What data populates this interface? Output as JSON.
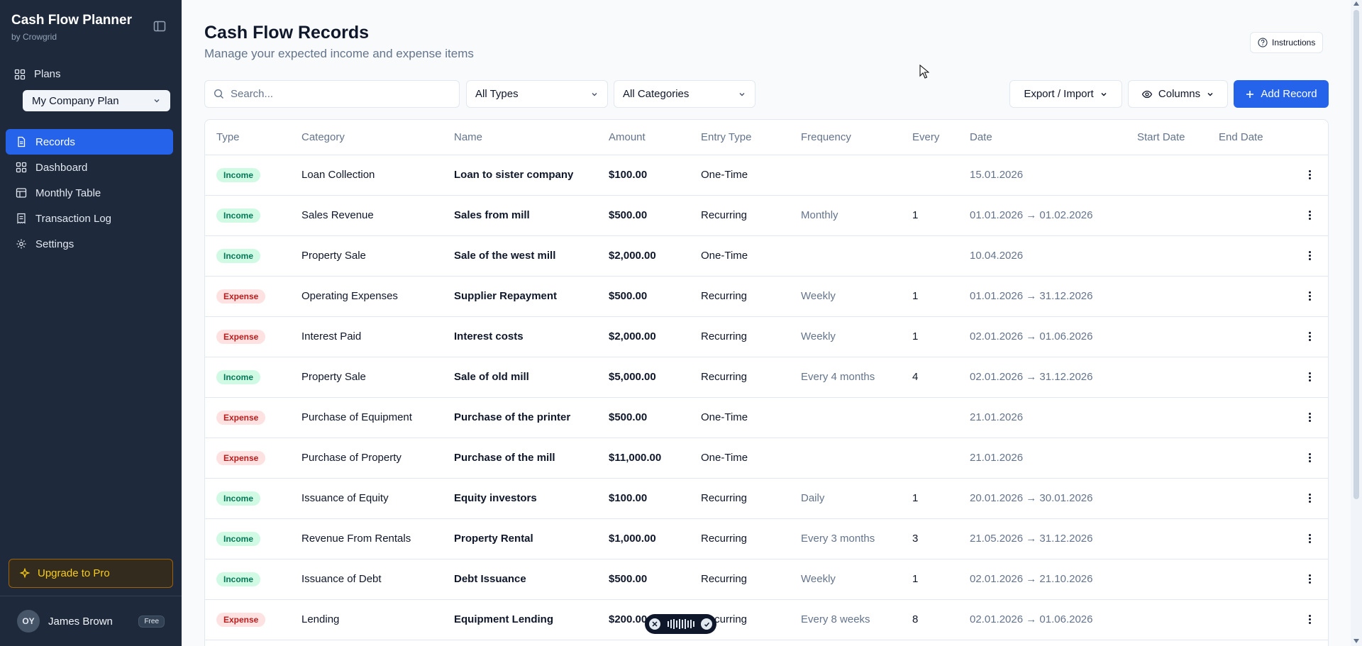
{
  "sidebar": {
    "app_title": "Cash Flow Planner",
    "app_subtitle": "by Crowgrid",
    "plans_label": "Plans",
    "plan_selected": "My Company Plan",
    "nav": [
      {
        "label": "Records",
        "icon": "file-text-icon",
        "active": true
      },
      {
        "label": "Dashboard",
        "icon": "grid-icon",
        "active": false
      },
      {
        "label": "Monthly Table",
        "icon": "table-icon",
        "active": false
      },
      {
        "label": "Transaction Log",
        "icon": "receipt-icon",
        "active": false
      },
      {
        "label": "Settings",
        "icon": "gear-icon",
        "active": false
      }
    ],
    "upgrade_label": "Upgrade to Pro",
    "user": {
      "initials": "OY",
      "name": "James Brown",
      "plan": "Free"
    }
  },
  "header": {
    "title": "Cash Flow Records",
    "subtitle": "Manage your expected income and expense items",
    "instructions_label": "Instructions"
  },
  "toolbar": {
    "search_placeholder": "Search...",
    "type_filter": "All Types",
    "category_filter": "All Categories",
    "export_import_label": "Export / Import",
    "columns_label": "Columns",
    "add_record_label": "Add Record"
  },
  "table": {
    "columns": [
      "Type",
      "Category",
      "Name",
      "Amount",
      "Entry Type",
      "Frequency",
      "Every",
      "Date",
      "Start Date",
      "End Date"
    ],
    "rows": [
      {
        "type": "Income",
        "category": "Loan Collection",
        "name": "Loan to sister company",
        "amount": "$100.00",
        "entry_type": "One-Time",
        "frequency": "",
        "every": "",
        "date": "15.01.2026"
      },
      {
        "type": "Income",
        "category": "Sales Revenue",
        "name": "Sales from mill",
        "amount": "$500.00",
        "entry_type": "Recurring",
        "frequency": "Monthly",
        "every": "1",
        "date": "01.01.2026 → 01.02.2026"
      },
      {
        "type": "Income",
        "category": "Property Sale",
        "name": "Sale of the west mill",
        "amount": "$2,000.00",
        "entry_type": "One-Time",
        "frequency": "",
        "every": "",
        "date": "10.04.2026"
      },
      {
        "type": "Expense",
        "category": "Operating Expenses",
        "name": "Supplier Repayment",
        "amount": "$500.00",
        "entry_type": "Recurring",
        "frequency": "Weekly",
        "every": "1",
        "date": "01.01.2026 → 31.12.2026"
      },
      {
        "type": "Expense",
        "category": "Interest Paid",
        "name": "Interest costs",
        "amount": "$2,000.00",
        "entry_type": "Recurring",
        "frequency": "Weekly",
        "every": "1",
        "date": "02.01.2026 → 01.06.2026"
      },
      {
        "type": "Income",
        "category": "Property Sale",
        "name": "Sale of old mill",
        "amount": "$5,000.00",
        "entry_type": "Recurring",
        "frequency": "Every 4 months",
        "every": "4",
        "date": "02.01.2026 → 31.12.2026"
      },
      {
        "type": "Expense",
        "category": "Purchase of Equipment",
        "name": "Purchase of the printer",
        "amount": "$500.00",
        "entry_type": "One-Time",
        "frequency": "",
        "every": "",
        "date": "21.01.2026"
      },
      {
        "type": "Expense",
        "category": "Purchase of Property",
        "name": "Purchase of the mill",
        "amount": "$11,000.00",
        "entry_type": "One-Time",
        "frequency": "",
        "every": "",
        "date": "21.01.2026"
      },
      {
        "type": "Income",
        "category": "Issuance of Equity",
        "name": "Equity investors",
        "amount": "$100.00",
        "entry_type": "Recurring",
        "frequency": "Daily",
        "every": "1",
        "date": "20.01.2026 → 30.01.2026"
      },
      {
        "type": "Income",
        "category": "Revenue From Rentals",
        "name": "Property Rental",
        "amount": "$1,000.00",
        "entry_type": "Recurring",
        "frequency": "Every 3 months",
        "every": "3",
        "date": "21.05.2026 → 31.12.2026"
      },
      {
        "type": "Income",
        "category": "Issuance of Debt",
        "name": "Debt Issuance",
        "amount": "$500.00",
        "entry_type": "Recurring",
        "frequency": "Weekly",
        "every": "1",
        "date": "02.01.2026 → 21.10.2026"
      },
      {
        "type": "Expense",
        "category": "Lending",
        "name": "Equipment Lending",
        "amount": "$200.00",
        "entry_type": "Recurring",
        "frequency": "Every 8 weeks",
        "every": "8",
        "date": "02.01.2026 → 01.06.2026"
      }
    ]
  },
  "colors": {
    "sidebar_bg": "#1e293b",
    "primary": "#2563eb",
    "income_badge": "#d1fae5",
    "expense_badge": "#fee2e2"
  }
}
